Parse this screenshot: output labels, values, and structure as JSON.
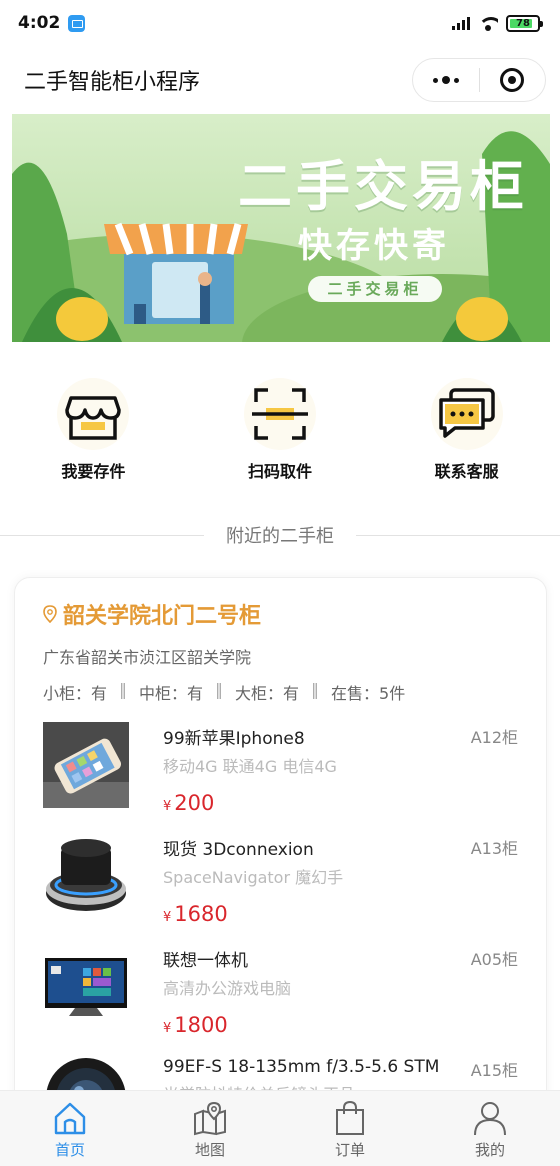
{
  "status_bar": {
    "time": "4:02",
    "battery": "78"
  },
  "nav": {
    "title": "二手智能柜小程序"
  },
  "banner": {
    "headline": "二手交易柜",
    "slogan": "快存快寄",
    "tag": "二手交易柜"
  },
  "actions": [
    {
      "label": "我要存件",
      "icon": "shop-icon"
    },
    {
      "label": "扫码取件",
      "icon": "scan-icon"
    },
    {
      "label": "联系客服",
      "icon": "chat-icon"
    }
  ],
  "section_title": "附近的二手柜",
  "cabinet": {
    "name": "韶关学院北门二号柜",
    "address": "广东省韶关市浈江区韶关学院",
    "stats": {
      "small": "小柜：有",
      "medium": "中柜：有",
      "large": "大柜：有",
      "on_sale": "在售：5件",
      "sep": "‖"
    },
    "products": [
      {
        "name": "99新苹果Iphone8",
        "desc": "移动4G 联通4G 电信4G",
        "price": "200",
        "slot": "A12柜"
      },
      {
        "name": "现货 3Dconnexion",
        "desc": "SpaceNavigator 魔幻手",
        "price": "1680",
        "slot": "A13柜"
      },
      {
        "name": "联想一体机",
        "desc": "高清办公游戏电脑",
        "price": "1800",
        "slot": "A05柜"
      },
      {
        "name": "99EF-S 18-135mm f/3.5-5.6 STM",
        "desc": "光学防抖特价单反镜头正品",
        "price": "",
        "slot": "A15柜"
      }
    ],
    "currency": "¥"
  },
  "tabbar": [
    {
      "label": "首页",
      "icon": "home-icon",
      "active": true
    },
    {
      "label": "地图",
      "icon": "map-icon",
      "active": false
    },
    {
      "label": "订单",
      "icon": "bag-icon",
      "active": false
    },
    {
      "label": "我的",
      "icon": "user-icon",
      "active": false
    }
  ],
  "colors": {
    "accent": "#e49a36",
    "price": "#d9262c",
    "tab_active": "#2d8ee7",
    "icon_yellow": "#f6c744"
  }
}
